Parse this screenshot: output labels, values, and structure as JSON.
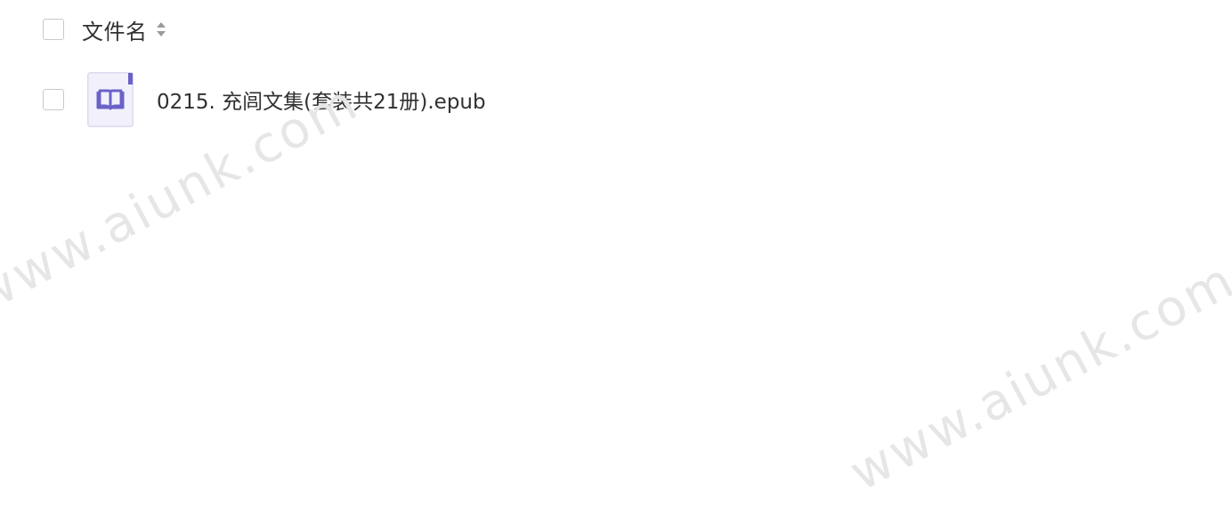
{
  "file_list": {
    "header": {
      "column_title": "文件名"
    },
    "files": [
      {
        "name": "0215. 充闾文集(套装共21册).epub",
        "icon": "epub-book-icon"
      }
    ]
  },
  "watermark": {
    "text": "www.aiunk.com"
  },
  "colors": {
    "icon_accent": "#6a62c8",
    "icon_bg": "#f1f0fb",
    "checkbox_border": "#c8c9cc",
    "text": "#303133"
  }
}
